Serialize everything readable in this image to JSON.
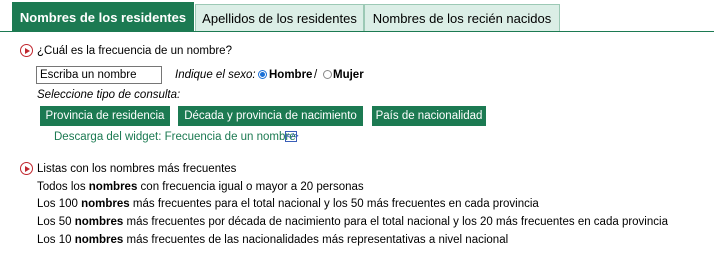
{
  "tabs": [
    {
      "label": "Nombres de los residentes",
      "active": true
    },
    {
      "label": "Apellidos de los residentes",
      "active": false
    },
    {
      "label": "Nombres de los recién nacidos",
      "active": false
    }
  ],
  "frequency": {
    "question": "¿Cuál es la frecuencia de un nombre?",
    "name_input_value": "Escriba un nombre",
    "sex_label": "Indique el sexo:",
    "sex_options": [
      {
        "label": "Hombre",
        "selected": true
      },
      {
        "label": "Mujer",
        "selected": false
      }
    ],
    "sex_separator": "/",
    "query_type_label": "Seleccione tipo de consulta:",
    "buttons": [
      "Provincia de residencia",
      "Década y provincia de nacimiento",
      "País de nacionalidad"
    ],
    "widget_link": "Descarga del widget: Frecuencia de un nombre",
    "widget_icon_text": "</>"
  },
  "lists": {
    "heading": "Listas con los nombres más frecuentes",
    "items": [
      {
        "pre": "Todos los ",
        "bold": "nombres",
        "post": " con frecuencia igual o mayor a 20 personas"
      },
      {
        "pre": "Los 100 ",
        "bold": "nombres",
        "post": " más frecuentes para el total nacional y los 50 más frecuentes en cada provincia"
      },
      {
        "pre": "Los 50 ",
        "bold": "nombres",
        "post": " más frecuentes por década de nacimiento para el total nacional y los 20 más frecuentes en cada provincia"
      },
      {
        "pre": "Los 10 ",
        "bold": "nombres",
        "post": " más frecuentes de las nacionalidades más representativas a nivel nacional"
      }
    ]
  },
  "colors": {
    "accent_green": "#1c7a52",
    "tab_inactive_bg": "#dbeee6",
    "bullet_red": "#c0262e"
  },
  "icons": {
    "section_bullet": "play-circle-icon",
    "widget": "code-embed-icon"
  }
}
